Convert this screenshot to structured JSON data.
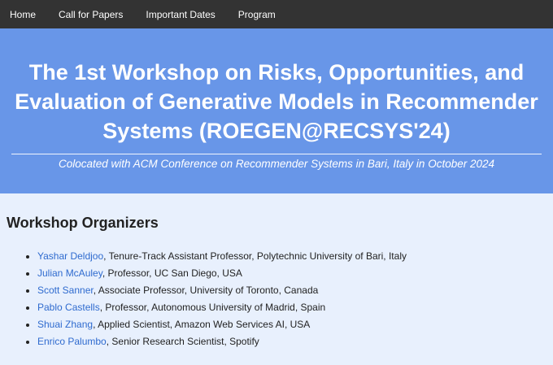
{
  "nav": {
    "items": [
      "Home",
      "Call for Papers",
      "Important Dates",
      "Program"
    ]
  },
  "hero": {
    "title": "The 1st Workshop on Risks, Opportunities, and Evaluation of Generative Models in Recommender Systems (ROEGEN@RECSYS'24)",
    "subtitle": "Colocated with ACM Conference on Recommender Systems in Bari, Italy in October 2024"
  },
  "organizers": {
    "heading": "Workshop Organizers",
    "people": [
      {
        "name": "Yashar Deldjoo",
        "role": ", Tenure-Track Assistant Professor, Polytechnic University of Bari, Italy"
      },
      {
        "name": "Julian McAuley",
        "role": ", Professor, UC San Diego, USA"
      },
      {
        "name": "Scott Sanner",
        "role": ", Associate Professor, University of Toronto, Canada"
      },
      {
        "name": "Pablo Castells",
        "role": ", Professor, Autonomous University of Madrid, Spain"
      },
      {
        "name": "Shuai Zhang",
        "role": ", Applied Scientist, Amazon Web Services AI, USA"
      },
      {
        "name": "Enrico Palumbo",
        "role": ", Senior Research Scientist, Spotify"
      }
    ]
  },
  "colors": {
    "navbar": "#333333",
    "hero": "#6896e8",
    "page": "#e8f0fd",
    "link": "#2f6bcf"
  }
}
